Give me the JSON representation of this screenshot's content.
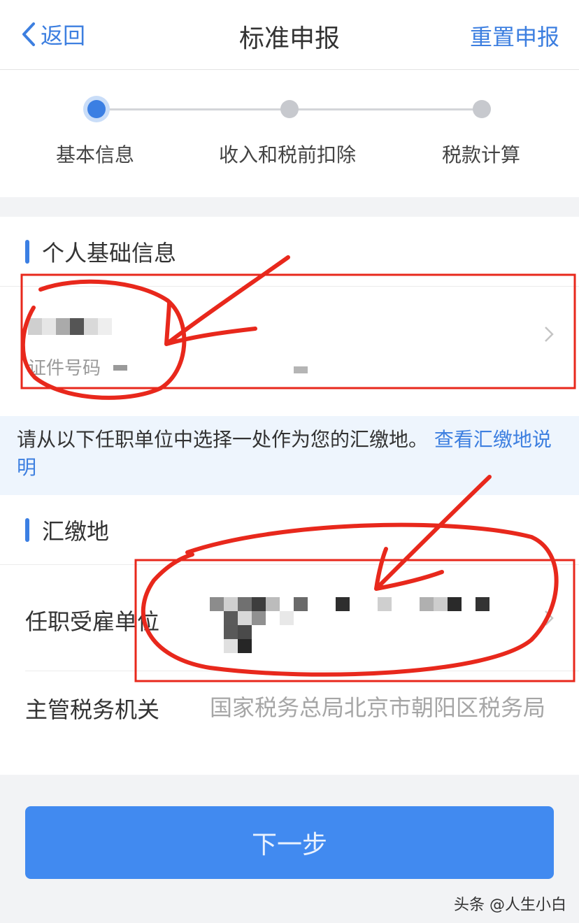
{
  "nav": {
    "back_label": "返回",
    "title": "标准申报",
    "reset_label": "重置申报"
  },
  "steps": [
    {
      "label": "基本信息",
      "active": true
    },
    {
      "label": "收入和税前扣除",
      "active": false
    },
    {
      "label": "税款计算",
      "active": false
    }
  ],
  "personal": {
    "heading": "个人基础信息",
    "id_label": "证件号码"
  },
  "notice": {
    "text": "请从以下任职单位中选择一处作为您的汇缴地。",
    "link": "查看汇缴地说明"
  },
  "location": {
    "heading": "汇缴地",
    "employer_label": "任职受雇单位",
    "tax_office_label": "主管税务机关",
    "tax_office_value": "国家税务总局北京市朝阳区税务局"
  },
  "next_button": "下一步",
  "watermark": "头条 @人生小白",
  "colors": {
    "accent": "#3d7fe0",
    "button": "#418af0",
    "annotation": "#e8281c"
  }
}
